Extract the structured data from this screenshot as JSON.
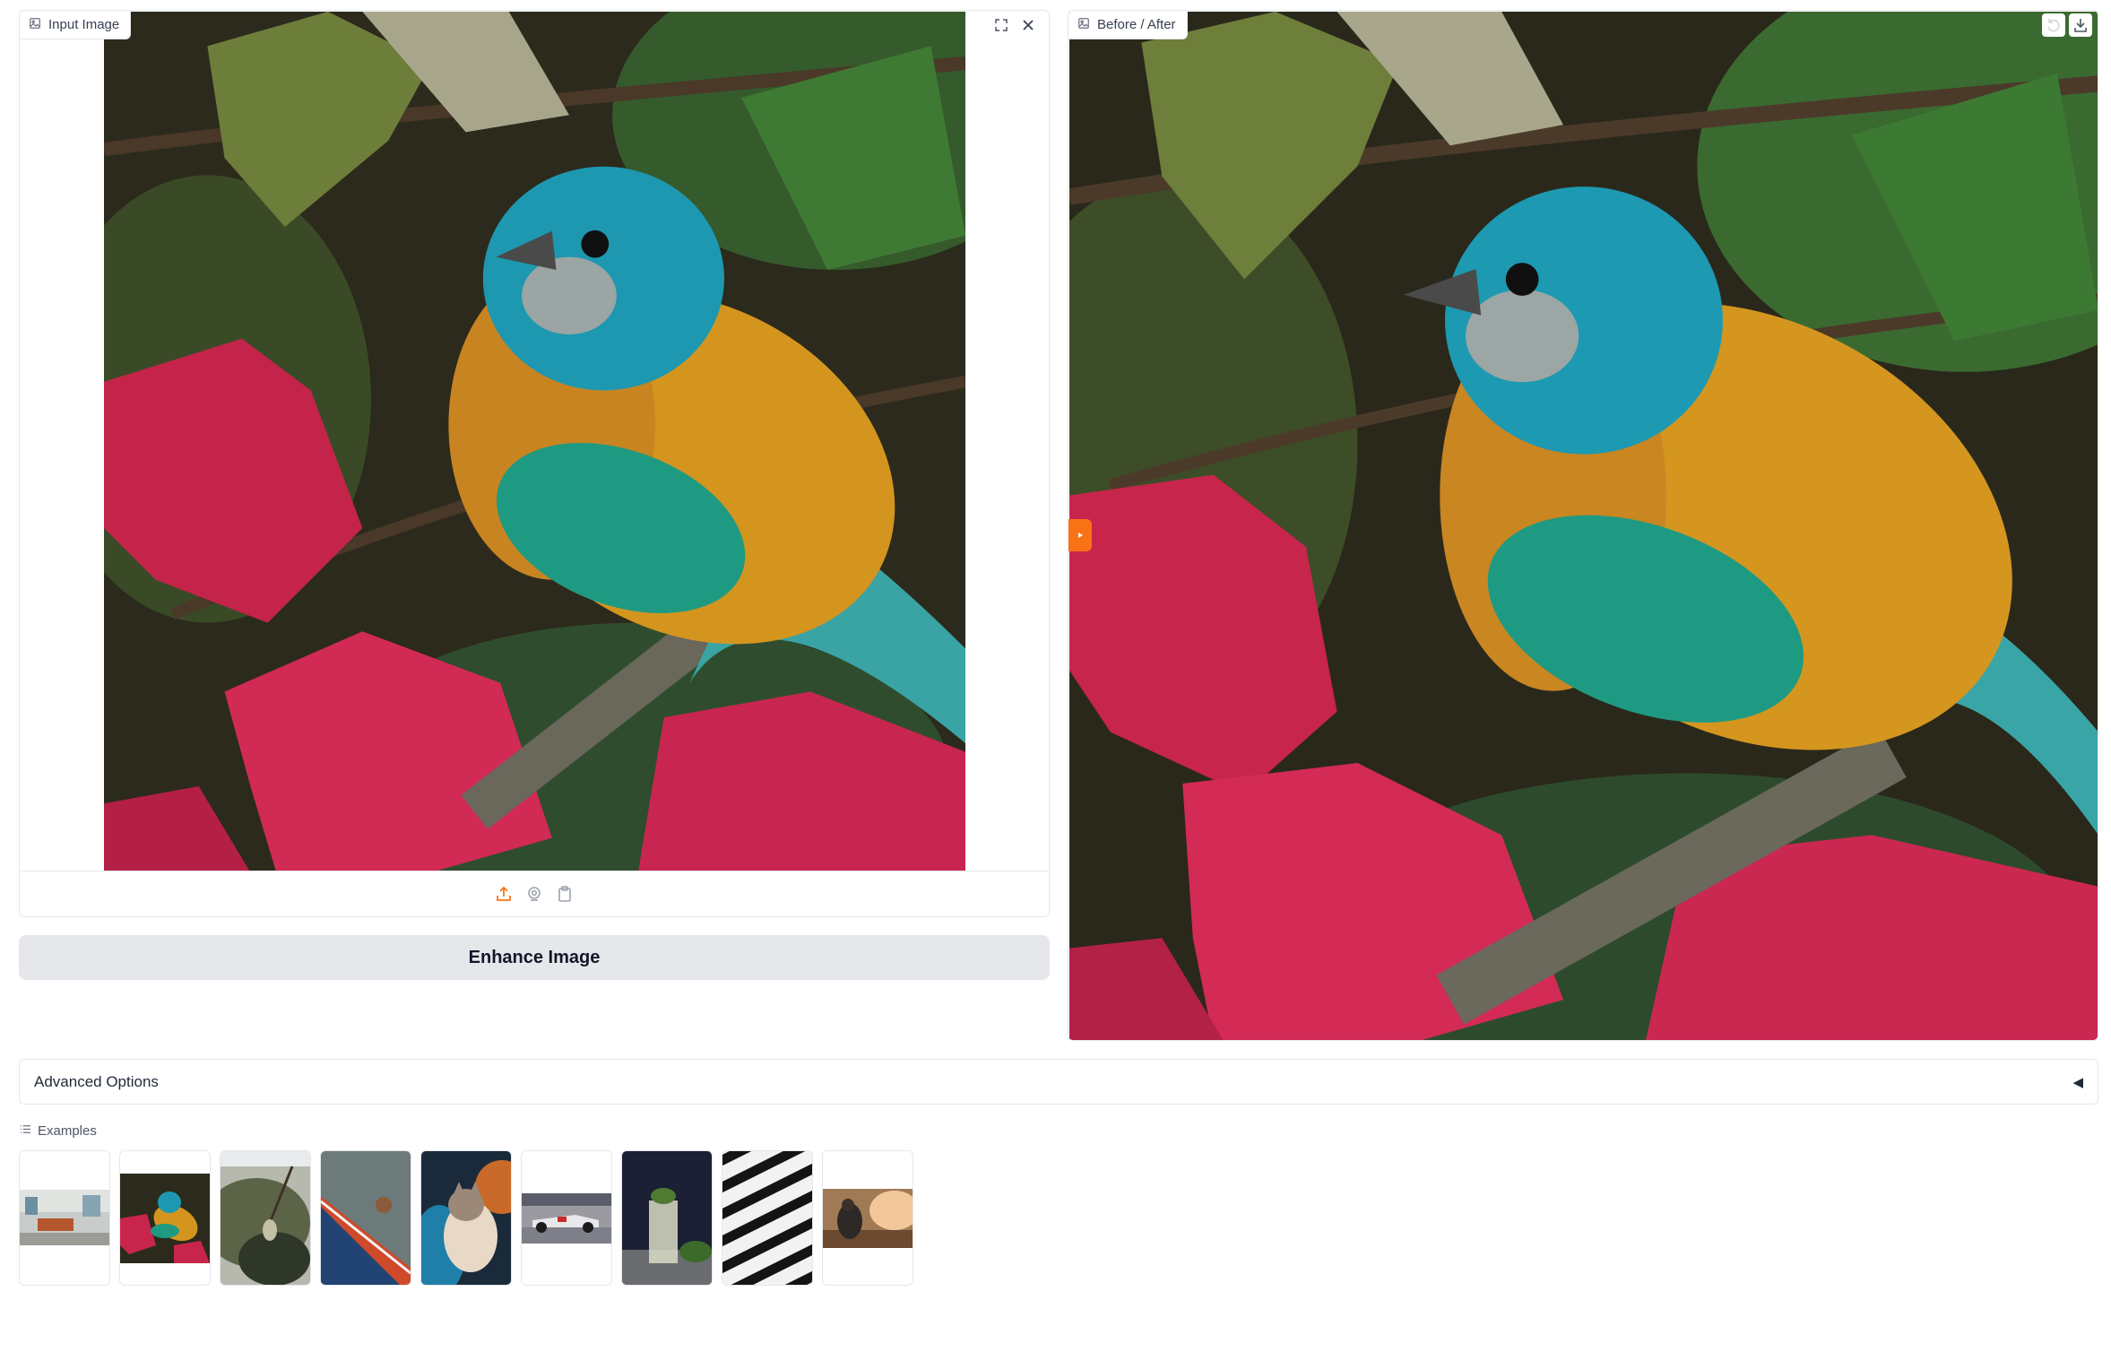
{
  "input_panel": {
    "label": "Input Image",
    "icons": [
      "image-icon",
      "fullscreen-icon",
      "close-icon"
    ],
    "sources": [
      "upload-icon",
      "webcam-icon",
      "clipboard-icon"
    ]
  },
  "output_panel": {
    "label": "Before / After",
    "icons": [
      "image-icon",
      "undo-icon",
      "download-icon"
    ],
    "slider_position": 0
  },
  "enhance_button": {
    "label": "Enhance Image"
  },
  "advanced_options": {
    "label": "Advanced Options",
    "arrow": "◀"
  },
  "examples": {
    "label": "Examples",
    "items": [
      "living-room",
      "bird",
      "hanging-plant",
      "tennis-court",
      "cat",
      "race-car",
      "cocktail",
      "zebra-pattern",
      "person-forest"
    ]
  },
  "colors": {
    "accent": "#f97316",
    "button_bg": "#e5e7eb",
    "border": "#e5e7eb"
  }
}
